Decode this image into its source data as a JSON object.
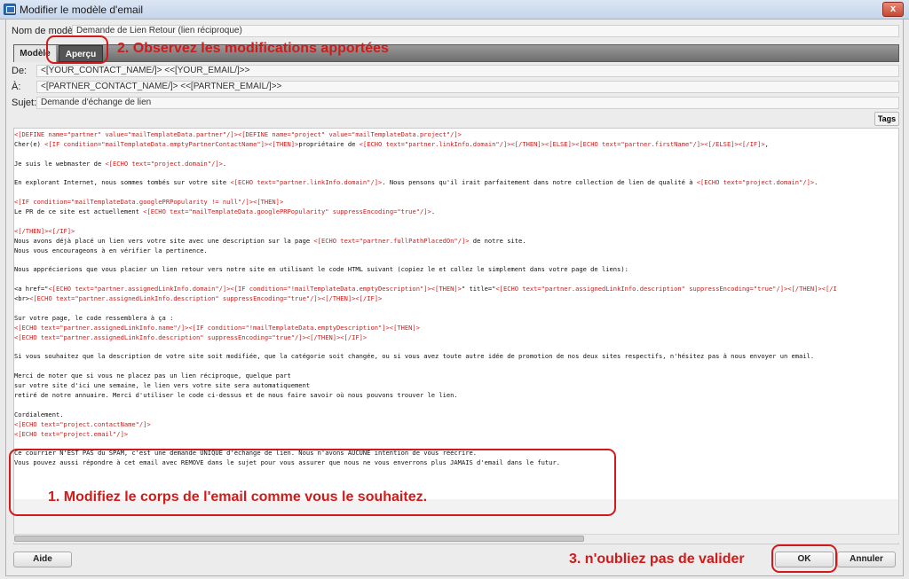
{
  "window": {
    "title": "Modifier le modèle d'email",
    "close_glyph": "x"
  },
  "fields": {
    "model_name_label": "Nom de modèle:",
    "model_name_value": "Demande de Lien Retour (lien réciproque)",
    "from_label": "De:",
    "from_value": "<[YOUR_CONTACT_NAME/]> <<[YOUR_EMAIL/]>>",
    "to_label": "À:",
    "to_value": "<[PARTNER_CONTACT_NAME/]> <<[PARTNER_EMAIL/]>>",
    "subject_label": "Sujet:",
    "subject_value": "Demande d'échange de lien"
  },
  "tabs": {
    "model": "Modèle",
    "preview": "Aperçu"
  },
  "tags_button": "Tags",
  "editor_lines": [
    [
      {
        "t": "<[DEFINE name=\"partner\" value=\"mailTemplateData.partner\"/]><[DEFINE name=\"project\" value=\"mailTemplateData.project\"/]>",
        "r": true
      }
    ],
    [
      {
        "t": "Cher(e) "
      },
      {
        "t": "<[IF condition=\"mailTemplateData.emptyPartnerContactName\"]><[THEN]>",
        "r": true
      },
      {
        "t": "propriétaire de "
      },
      {
        "t": "<[ECHO text=\"partner.linkInfo.domain\"/]><[/THEN]><[ELSE]><[ECHO text=\"partner.firstName\"/]><[/ELSE]><[/IF]>",
        "r": true
      },
      {
        "t": ","
      }
    ],
    [
      {
        "t": ""
      }
    ],
    [
      {
        "t": "Je suis le webmaster de "
      },
      {
        "t": "<[ECHO text=\"project.domain\"/]>",
        "r": true
      },
      {
        "t": "."
      }
    ],
    [
      {
        "t": ""
      }
    ],
    [
      {
        "t": "En explorant Internet, nous sommes tombés sur votre site "
      },
      {
        "t": "<[ECHO text=\"partner.linkInfo.domain\"/]>",
        "r": true
      },
      {
        "t": ". Nous pensons qu'il irait parfaitement dans notre collection de lien de qualité à "
      },
      {
        "t": "<[ECHO text=\"project.domain\"/]>",
        "r": true
      },
      {
        "t": "."
      }
    ],
    [
      {
        "t": ""
      }
    ],
    [
      {
        "t": "<[IF condition=\"mailTemplateData.googlePRPopularity != null\"/]><[THEN]>",
        "r": true
      }
    ],
    [
      {
        "t": "Le PR de ce site est actuellement "
      },
      {
        "t": "<[ECHO text=\"mailTemplateData.googlePRPopularity\" suppressEncoding=\"true\"/]>",
        "r": true
      },
      {
        "t": "."
      }
    ],
    [
      {
        "t": ""
      }
    ],
    [
      {
        "t": "<[/THEN]><[/IF]>",
        "r": true
      }
    ],
    [
      {
        "t": "Nous avons déjà placé un lien vers votre site avec une description sur la page "
      },
      {
        "t": "<[ECHO text=\"partner.fullPathPlacedOn\"/]>",
        "r": true
      },
      {
        "t": " de notre site."
      }
    ],
    [
      {
        "t": "Nous vous encourageons à en vérifier la pertinence."
      }
    ],
    [
      {
        "t": ""
      }
    ],
    [
      {
        "t": "Nous apprécierions que vous placier un lien retour vers notre site en utilisant le code HTML suivant (copiez le et collez le simplement dans votre page de liens):"
      }
    ],
    [
      {
        "t": ""
      }
    ],
    [
      {
        "t": "<a href=\""
      },
      {
        "t": "<[ECHO text=\"partner.assignedLinkInfo.domain\"/]><[IF condition=\"!mailTemplateData.emptyDescription\"]><[THEN]>",
        "r": true
      },
      {
        "t": "\" title=\""
      },
      {
        "t": "<[ECHO text=\"partner.assignedLinkInfo.description\" suppressEncoding=\"true\"/]><[/THEN]><[/I",
        "r": true
      }
    ],
    [
      {
        "t": "<br>"
      },
      {
        "t": "<[ECHO text=\"partner.assignedLinkInfo.description\" suppressEncoding=\"true\"/]><[/THEN]><[/IF]>",
        "r": true
      }
    ],
    [
      {
        "t": ""
      }
    ],
    [
      {
        "t": "Sur votre page, le code ressemblera à ça :"
      }
    ],
    [
      {
        "t": "<[ECHO text=\"partner.assignedLinkInfo.name\"/]><[IF condition=\"!mailTemplateData.emptyDescription\"]><[THEN]>",
        "r": true
      }
    ],
    [
      {
        "t": "<[ECHO text=\"partner.assignedLinkInfo.description\" suppressEncoding=\"true\"/]><[/THEN]><[/IF]>",
        "r": true
      }
    ],
    [
      {
        "t": ""
      }
    ],
    [
      {
        "t": "Si vous souhaitez que la description de votre site soit modifiée, que la catégorie soit changée, ou si vous avez toute autre idée de promotion de nos deux sites respectifs, n'hésitez pas à nous envoyer un email."
      }
    ],
    [
      {
        "t": ""
      }
    ],
    [
      {
        "t": "Merci de noter que si vous ne placez pas un lien réciproque, quelque part"
      }
    ],
    [
      {
        "t": "sur votre site d'ici une semaine, le lien vers votre site sera automatiquement"
      }
    ],
    [
      {
        "t": "retiré de notre annuaire. Merci d'utiliser le code ci-dessus et de nous faire savoir où nous pouvons trouver le lien."
      }
    ],
    [
      {
        "t": ""
      }
    ],
    [
      {
        "t": "Cordialement."
      }
    ],
    [
      {
        "t": "<[ECHO text=\"project.contactName\"/]>",
        "r": true
      }
    ],
    [
      {
        "t": "<[ECHO text=\"project.email\"/]>",
        "r": true
      }
    ],
    [
      {
        "t": ""
      }
    ],
    [
      {
        "t": "Ce courrier N'EST PAS du SPAM, c'est une demande UNIQUE d'échange de lien. Nous n'avons AUCUNE intention de vous réécrire."
      }
    ],
    [
      {
        "t": "Vous pouvez aussi répondre à cet email avec REMOVE dans le sujet pour vous assurer que nous ne vous enverrons plus JAMAIS d'email dans le futur."
      }
    ]
  ],
  "buttons": {
    "help": "Aide",
    "ok": "OK",
    "cancel": "Annuler"
  },
  "annotations": {
    "step1": "1. Modifiez le corps de l'email comme vous le souhaitez.",
    "step2": "2. Observez les modifications apportées",
    "step3": "3. n'oubliez pas de valider"
  },
  "colors": {
    "annotation": "#d11a1a",
    "template_tag": "#c8201e"
  },
  "icons": {
    "app": "app-window-icon",
    "close": "close-icon"
  }
}
